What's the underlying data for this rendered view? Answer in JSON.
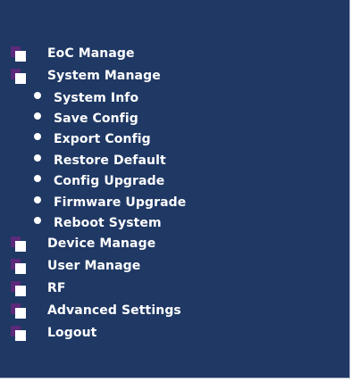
{
  "colors": {
    "panel_background": "#1f3864",
    "icon_back": "#5b2a7a",
    "icon_front": "#ffffff",
    "text": "#ffffff"
  },
  "menu": {
    "eoc_manage": {
      "label": "EoC Manage",
      "icon": "folder-icon"
    },
    "system_manage": {
      "label": "System Manage",
      "icon": "folder-icon",
      "expanded": true,
      "children": [
        {
          "label": "System Info",
          "icon": "bullet-icon"
        },
        {
          "label": "Save Config",
          "icon": "bullet-icon"
        },
        {
          "label": "Export Config",
          "icon": "bullet-icon"
        },
        {
          "label": "Restore Default",
          "icon": "bullet-icon"
        },
        {
          "label": "Config Upgrade",
          "icon": "bullet-icon"
        },
        {
          "label": "Firmware Upgrade",
          "icon": "bullet-icon"
        },
        {
          "label": "Reboot System",
          "icon": "bullet-icon"
        }
      ]
    },
    "device_manage": {
      "label": "Device Manage",
      "icon": "folder-icon"
    },
    "user_manage": {
      "label": "User Manage",
      "icon": "folder-icon"
    },
    "rf": {
      "label": "RF",
      "icon": "folder-icon"
    },
    "advanced_settings": {
      "label": "Advanced Settings",
      "icon": "folder-icon"
    },
    "logout": {
      "label": "Logout",
      "icon": "folder-icon"
    }
  }
}
